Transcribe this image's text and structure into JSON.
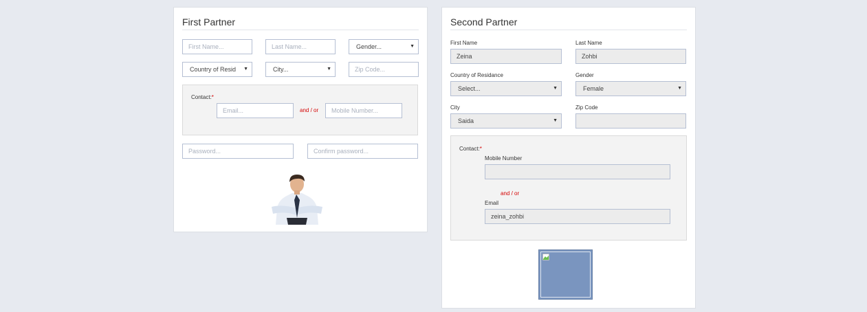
{
  "first_partner": {
    "title": "First Partner",
    "first_name_placeholder": "First Name...",
    "last_name_placeholder": "Last Name...",
    "gender_select": "Gender...",
    "country_select": "Country of Resid",
    "city_select": "City...",
    "zip_placeholder": "Zip Code...",
    "contact_label": "Contact:",
    "required_mark": "*",
    "email_placeholder": "Email...",
    "and_or": "and / or",
    "mobile_placeholder": "Mobile Number...",
    "password_placeholder": "Password...",
    "confirm_password_placeholder": "Confirm password..."
  },
  "second_partner": {
    "title": "Second Partner",
    "first_name_label": "First Name",
    "first_name_value": "Zeina",
    "last_name_label": "Last Name",
    "last_name_value": "Zohbi",
    "country_label": "Country of Residance",
    "country_select": "Select...",
    "gender_label": "Gender",
    "gender_select": "Female",
    "city_label": "City",
    "city_select": "Saida",
    "zip_label": "Zip Code",
    "zip_value": "",
    "contact_label": "Contact:",
    "required_mark": "*",
    "mobile_label": "Mobile Number",
    "mobile_value": "",
    "and_or": "and / or",
    "email_label": "Email",
    "email_value": "zeina_zohbi"
  },
  "icons": {
    "dropdown": "▼"
  },
  "colors": {
    "required": "#d40000",
    "input_border": "#b5bfd3",
    "page_bg": "#e7eaf0"
  }
}
